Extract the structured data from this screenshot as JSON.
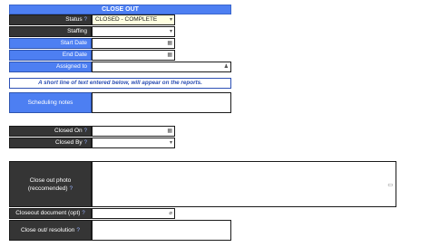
{
  "header": {
    "title": "CLOSE OUT"
  },
  "fields": {
    "status": {
      "label": "Status",
      "value": "CLOSED - COMPLETE"
    },
    "staffing": {
      "label": "Staffing",
      "value": ""
    },
    "start_date": {
      "label": "Start Date",
      "value": ""
    },
    "end_date": {
      "label": "End Date",
      "value": ""
    },
    "assigned_to": {
      "label": "Assigned to",
      "value": ""
    },
    "notice": "A short line of text entered below, will appear on the reports.",
    "scheduling_notes": {
      "label": "Scheduling notes"
    },
    "closed_on": {
      "label": "Closed On",
      "value": ""
    },
    "closed_by": {
      "label": "Closed By",
      "value": ""
    },
    "closeout_photo": {
      "label_line1": "Close out photo",
      "label_line2": "(reccomended)"
    },
    "closeout_document": {
      "label": "Closeout document (opt)"
    },
    "closeout_resolution": {
      "label": "Close out/ resolution"
    }
  },
  "icons": {
    "dropdown": "▾",
    "calendar": "▦",
    "person": "♟",
    "paperclip": "⌀",
    "help": "?",
    "image": "▭"
  },
  "colors": {
    "accent": "#4d7ff2",
    "dark_label": "#353535"
  }
}
